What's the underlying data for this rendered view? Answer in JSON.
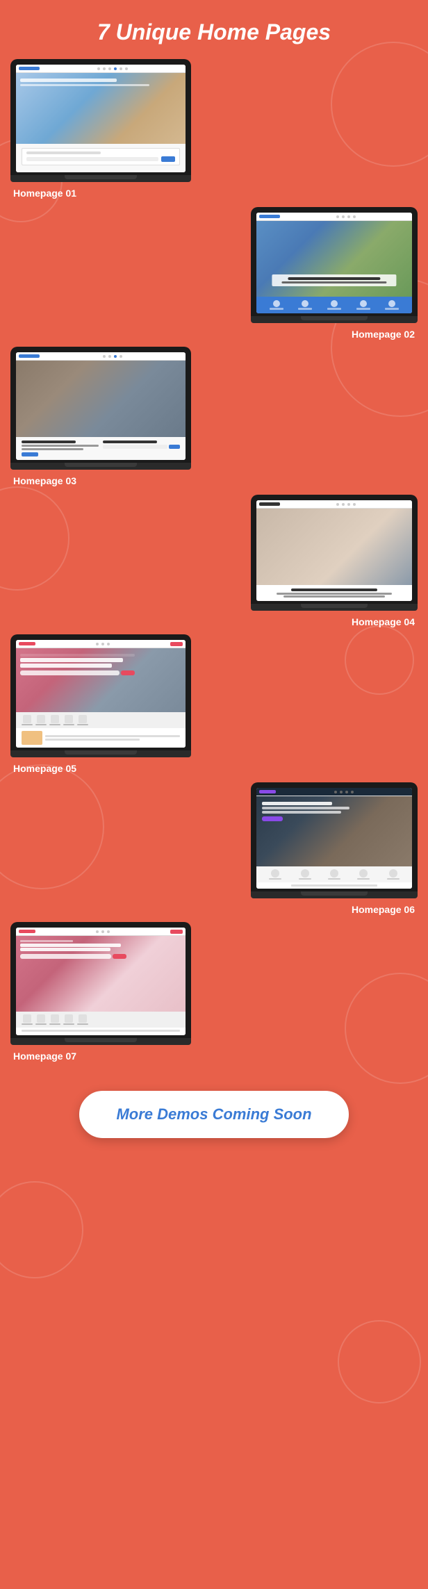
{
  "page": {
    "title": "7 Unique Home Pages",
    "background_color": "#e8604a"
  },
  "homepages": [
    {
      "id": 1,
      "label": "Homepage 01",
      "position": "left",
      "hero_class": "hero-1"
    },
    {
      "id": 2,
      "label": "Homepage 02",
      "position": "right",
      "hero_class": "hero-2"
    },
    {
      "id": 3,
      "label": "Homepage 03",
      "position": "left",
      "hero_class": "hero-3"
    },
    {
      "id": 4,
      "label": "Homepage 04",
      "position": "right",
      "hero_class": "hero-4"
    },
    {
      "id": 5,
      "label": "Homepage 05",
      "position": "left",
      "hero_class": "hero-5"
    },
    {
      "id": 6,
      "label": "Homepage 06",
      "position": "right",
      "hero_class": "hero-6"
    },
    {
      "id": 7,
      "label": "Homepage 07",
      "position": "left",
      "hero_class": "hero-7"
    }
  ],
  "cta": {
    "label": "More Demos Coming Soon"
  }
}
